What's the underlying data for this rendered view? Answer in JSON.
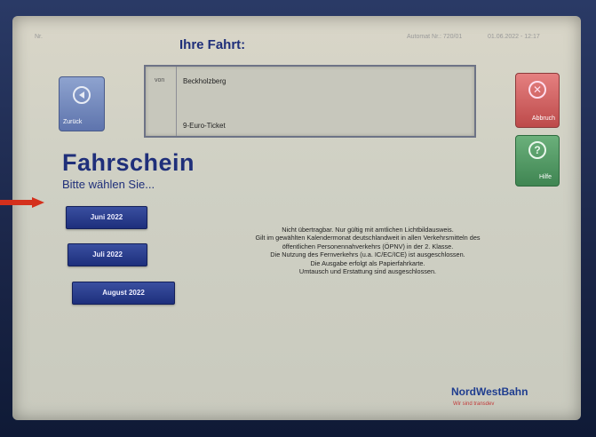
{
  "header": {
    "title": "Ihre Fahrt:",
    "status_left": "Nr.",
    "machine": "Automat Nr.: 720/01",
    "datetime": "01.06.2022 - 12:17"
  },
  "trip": {
    "von_label": "von",
    "from": "Beckholzberg",
    "ticket": "9-Euro-Ticket"
  },
  "buttons": {
    "back": "Zurück",
    "abort": "Abbruch",
    "help": "Hilfe"
  },
  "main": {
    "title": "Fahrschein",
    "subtitle": "Bitte wählen Sie...",
    "months": [
      "Juni 2022",
      "Juli 2022",
      "August 2022"
    ]
  },
  "info": {
    "lines": [
      "Nicht übertragbar. Nur gültig mit amtlichen Lichtbildausweis.",
      "Gilt im gewählten Kalendermonat deutschlandweit in allen Verkehrsmitteln des",
      "öffentlichen Personennahverkehrs (ÖPNV) in der 2. Klasse.",
      "Die Nutzung des Fernverkehrs (u.a. IC/EC/ICE) ist ausgeschlossen.",
      "Die Ausgabe erfolgt als Papierfahrkarte.",
      "Umtausch und Erstattung sind ausgeschlossen."
    ]
  },
  "brand": {
    "name": "NordWestBahn",
    "sub": "Wir sind transdev"
  },
  "colors": {
    "primary_blue": "#1f2f7a",
    "abort_red": "#c85555",
    "help_green": "#4a8f5c",
    "arrow_red": "#d4301c"
  },
  "icons": {
    "back": "arrow-left-circle-icon",
    "abort": "x-circle-icon",
    "help": "question-circle-icon"
  }
}
